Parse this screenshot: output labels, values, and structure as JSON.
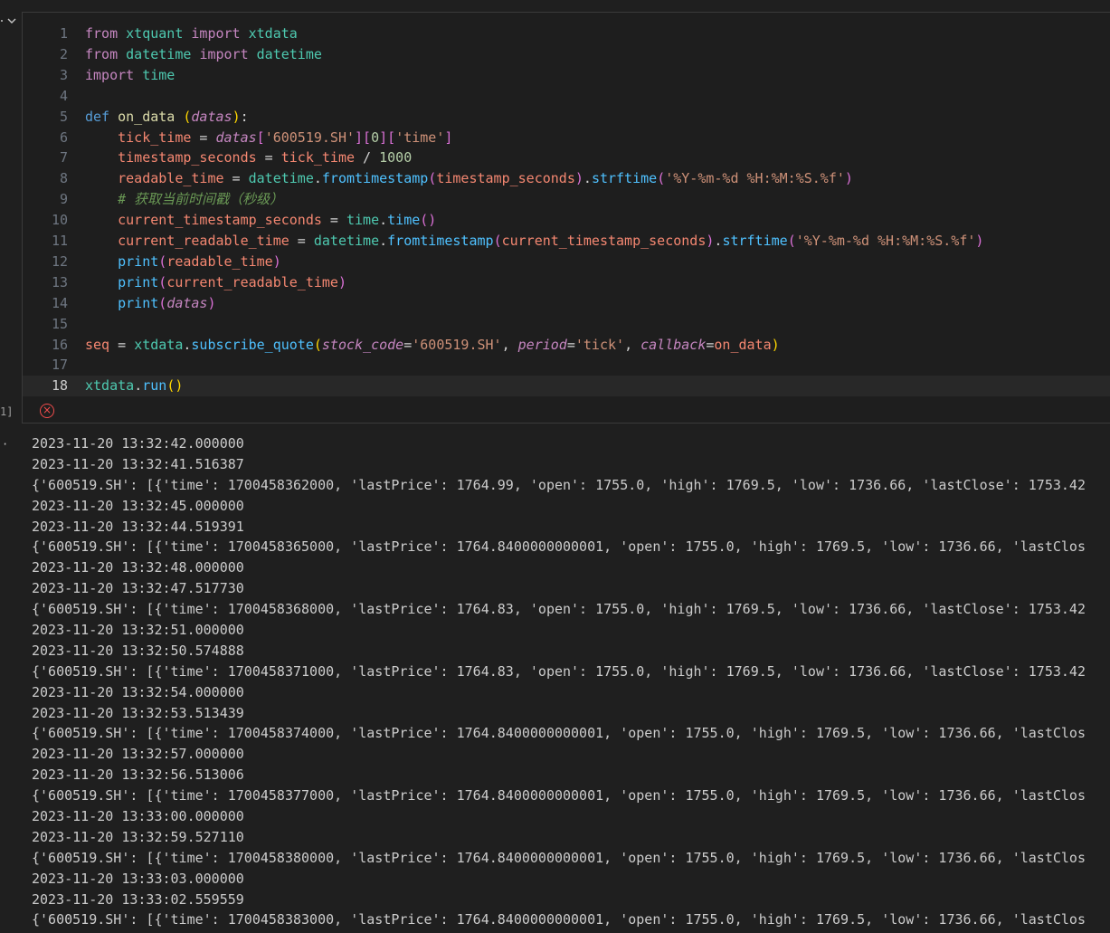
{
  "cell": {
    "collapse_icon": "chevron-down-icon",
    "execution_count": "1]",
    "status_icon": "error-circle-icon"
  },
  "code_lines": [
    {
      "n": "1",
      "tokens": [
        [
          "k",
          "from"
        ],
        [
          "o",
          " "
        ],
        [
          "m",
          "xtquant"
        ],
        [
          "o",
          " "
        ],
        [
          "k",
          "import"
        ],
        [
          "o",
          " "
        ],
        [
          "m",
          "xtdata"
        ]
      ]
    },
    {
      "n": "2",
      "tokens": [
        [
          "k",
          "from"
        ],
        [
          "o",
          " "
        ],
        [
          "m",
          "datetime"
        ],
        [
          "o",
          " "
        ],
        [
          "k",
          "import"
        ],
        [
          "o",
          " "
        ],
        [
          "m",
          "datetime"
        ]
      ]
    },
    {
      "n": "3",
      "tokens": [
        [
          "k",
          "import"
        ],
        [
          "o",
          " "
        ],
        [
          "m",
          "time"
        ]
      ]
    },
    {
      "n": "4",
      "tokens": []
    },
    {
      "n": "5",
      "tokens": [
        [
          "kd",
          "def"
        ],
        [
          "o",
          " "
        ],
        [
          "fn",
          "on_data"
        ],
        [
          "o",
          " "
        ],
        [
          "pn1",
          "("
        ],
        [
          "p",
          "datas"
        ],
        [
          "pn1",
          ")"
        ],
        [
          "o",
          ":"
        ]
      ]
    },
    {
      "n": "6",
      "tokens": [
        [
          "o",
          "    "
        ],
        [
          "v",
          "tick_time"
        ],
        [
          "o",
          " = "
        ],
        [
          "p",
          "datas"
        ],
        [
          "pn2",
          "["
        ],
        [
          "s",
          "'600519.SH'"
        ],
        [
          "pn2",
          "]["
        ],
        [
          "n",
          "0"
        ],
        [
          "pn2",
          "]["
        ],
        [
          "s",
          "'time'"
        ],
        [
          "pn2",
          "]"
        ]
      ]
    },
    {
      "n": "7",
      "tokens": [
        [
          "o",
          "    "
        ],
        [
          "v",
          "timestamp_seconds"
        ],
        [
          "o",
          " = "
        ],
        [
          "v",
          "tick_time"
        ],
        [
          "o",
          " / "
        ],
        [
          "n",
          "1000"
        ]
      ]
    },
    {
      "n": "8",
      "tokens": [
        [
          "o",
          "    "
        ],
        [
          "v",
          "readable_time"
        ],
        [
          "o",
          " = "
        ],
        [
          "m",
          "datetime"
        ],
        [
          "o",
          "."
        ],
        [
          "f",
          "fromtimestamp"
        ],
        [
          "pn2",
          "("
        ],
        [
          "v",
          "timestamp_seconds"
        ],
        [
          "pn2",
          ")"
        ],
        [
          "o",
          "."
        ],
        [
          "f",
          "strftime"
        ],
        [
          "pn2",
          "("
        ],
        [
          "s",
          "'%Y-%m-%d %H:%M:%S.%f'"
        ],
        [
          "pn2",
          ")"
        ]
      ]
    },
    {
      "n": "9",
      "tokens": [
        [
          "o",
          "    "
        ],
        [
          "c",
          "# 获取当前时间戳（秒级）"
        ]
      ]
    },
    {
      "n": "10",
      "tokens": [
        [
          "o",
          "    "
        ],
        [
          "v",
          "current_timestamp_seconds"
        ],
        [
          "o",
          " = "
        ],
        [
          "m",
          "time"
        ],
        [
          "o",
          "."
        ],
        [
          "f",
          "time"
        ],
        [
          "pn2",
          "()"
        ]
      ]
    },
    {
      "n": "11",
      "tokens": [
        [
          "o",
          "    "
        ],
        [
          "v",
          "current_readable_time"
        ],
        [
          "o",
          " = "
        ],
        [
          "m",
          "datetime"
        ],
        [
          "o",
          "."
        ],
        [
          "f",
          "fromtimestamp"
        ],
        [
          "pn2",
          "("
        ],
        [
          "v",
          "current_timestamp_seconds"
        ],
        [
          "pn2",
          ")"
        ],
        [
          "o",
          "."
        ],
        [
          "f",
          "strftime"
        ],
        [
          "pn2",
          "("
        ],
        [
          "s",
          "'%Y-%m-%d %H:%M:%S.%f'"
        ],
        [
          "pn2",
          ")"
        ]
      ]
    },
    {
      "n": "12",
      "tokens": [
        [
          "o",
          "    "
        ],
        [
          "f",
          "print"
        ],
        [
          "pn2",
          "("
        ],
        [
          "v",
          "readable_time"
        ],
        [
          "pn2",
          ")"
        ]
      ]
    },
    {
      "n": "13",
      "tokens": [
        [
          "o",
          "    "
        ],
        [
          "f",
          "print"
        ],
        [
          "pn2",
          "("
        ],
        [
          "v",
          "current_readable_time"
        ],
        [
          "pn2",
          ")"
        ]
      ]
    },
    {
      "n": "14",
      "tokens": [
        [
          "o",
          "    "
        ],
        [
          "f",
          "print"
        ],
        [
          "pn2",
          "("
        ],
        [
          "p",
          "datas"
        ],
        [
          "pn2",
          ")"
        ]
      ]
    },
    {
      "n": "15",
      "tokens": []
    },
    {
      "n": "16",
      "tokens": [
        [
          "v",
          "seq"
        ],
        [
          "o",
          " = "
        ],
        [
          "m",
          "xtdata"
        ],
        [
          "o",
          "."
        ],
        [
          "f",
          "subscribe_quote"
        ],
        [
          "pn1",
          "("
        ],
        [
          "p",
          "stock_code"
        ],
        [
          "o",
          "="
        ],
        [
          "s",
          "'600519.SH'"
        ],
        [
          "o",
          ", "
        ],
        [
          "p",
          "period"
        ],
        [
          "o",
          "="
        ],
        [
          "s",
          "'tick'"
        ],
        [
          "o",
          ", "
        ],
        [
          "p",
          "callback"
        ],
        [
          "o",
          "="
        ],
        [
          "v",
          "on_data"
        ],
        [
          "pn1",
          ")"
        ]
      ]
    },
    {
      "n": "17",
      "tokens": []
    },
    {
      "n": "18",
      "tokens": [
        [
          "m",
          "xtdata"
        ],
        [
          "o",
          "."
        ],
        [
          "f",
          "run"
        ],
        [
          "pn1",
          "()"
        ]
      ]
    }
  ],
  "output_lines": [
    "2023-11-20 13:32:42.000000",
    "2023-11-20 13:32:41.516387",
    "{'600519.SH': [{'time': 1700458362000, 'lastPrice': 1764.99, 'open': 1755.0, 'high': 1769.5, 'low': 1736.66, 'lastClose': 1753.42",
    "2023-11-20 13:32:45.000000",
    "2023-11-20 13:32:44.519391",
    "{'600519.SH': [{'time': 1700458365000, 'lastPrice': 1764.8400000000001, 'open': 1755.0, 'high': 1769.5, 'low': 1736.66, 'lastClos",
    "2023-11-20 13:32:48.000000",
    "2023-11-20 13:32:47.517730",
    "{'600519.SH': [{'time': 1700458368000, 'lastPrice': 1764.83, 'open': 1755.0, 'high': 1769.5, 'low': 1736.66, 'lastClose': 1753.42",
    "2023-11-20 13:32:51.000000",
    "2023-11-20 13:32:50.574888",
    "{'600519.SH': [{'time': 1700458371000, 'lastPrice': 1764.83, 'open': 1755.0, 'high': 1769.5, 'low': 1736.66, 'lastClose': 1753.42",
    "2023-11-20 13:32:54.000000",
    "2023-11-20 13:32:53.513439",
    "{'600519.SH': [{'time': 1700458374000, 'lastPrice': 1764.8400000000001, 'open': 1755.0, 'high': 1769.5, 'low': 1736.66, 'lastClos",
    "2023-11-20 13:32:57.000000",
    "2023-11-20 13:32:56.513006",
    "{'600519.SH': [{'time': 1700458377000, 'lastPrice': 1764.8400000000001, 'open': 1755.0, 'high': 1769.5, 'low': 1736.66, 'lastClos",
    "2023-11-20 13:33:00.000000",
    "2023-11-20 13:32:59.527110",
    "{'600519.SH': [{'time': 1700458380000, 'lastPrice': 1764.8400000000001, 'open': 1755.0, 'high': 1769.5, 'low': 1736.66, 'lastClos",
    "2023-11-20 13:33:03.000000",
    "2023-11-20 13:33:02.559559",
    "{'600519.SH': [{'time': 1700458383000, 'lastPrice': 1764.8400000000001, 'open': 1755.0, 'high': 1769.5, 'low': 1736.66, 'lastClos"
  ],
  "current_line": "18"
}
